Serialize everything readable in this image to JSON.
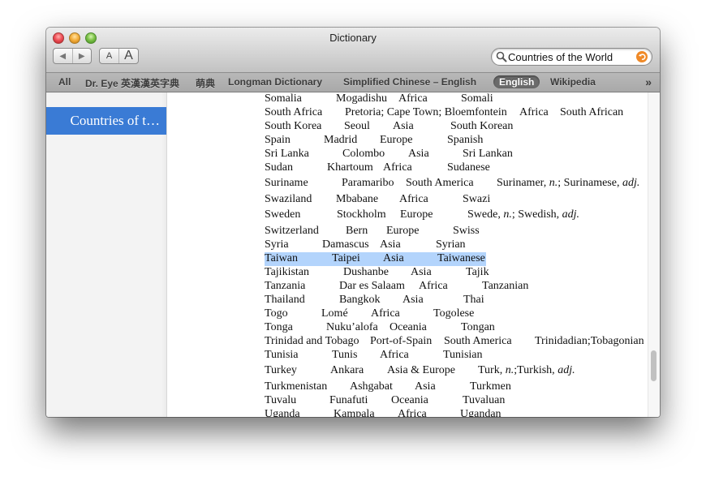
{
  "window": {
    "title": "Dictionary",
    "traffic_lights": [
      "close",
      "minimize",
      "zoom"
    ]
  },
  "toolbar": {
    "back_icon": "triangle-left-icon",
    "forward_icon": "triangle-right-icon",
    "back_glyph": "◀",
    "forward_glyph": "▶",
    "font_smaller_label": "A",
    "font_larger_label": "A",
    "search": {
      "value": "Countries of the World",
      "icon": "magnifier-icon",
      "clear_icon": "clear-circle-icon"
    }
  },
  "sources": {
    "tabs": [
      {
        "label": "All",
        "active": false
      },
      {
        "label": "Dr. Eye 英漢漢英字典",
        "active": false
      },
      {
        "label": "萌典",
        "active": false
      },
      {
        "label": "Longman Dictionary",
        "active": false
      },
      {
        "label": "Simplified Chinese – English",
        "active": false
      },
      {
        "label": "English",
        "active": true
      },
      {
        "label": "Wikipedia",
        "active": false
      }
    ],
    "more_glyph": "»"
  },
  "sidebar": {
    "items": [
      {
        "label": "Countries of t…",
        "selected": true
      }
    ]
  },
  "entry": {
    "rows": [
      {
        "country": "Somalia",
        "capital": "Mogadishu",
        "continent": "Africa",
        "adjective": "Somali"
      },
      {
        "country": "South Africa",
        "capital": "Pretoria; Cape Town; Bloemfontein",
        "continent": "Africa",
        "adjective": "South African"
      },
      {
        "country": "South Korea",
        "capital": "Seoul",
        "continent": "Asia",
        "adjective": "South Korean"
      },
      {
        "country": "Spain",
        "capital": "Madrid",
        "continent": "Europe",
        "adjective": "Spanish"
      },
      {
        "country": "Sri Lanka",
        "capital": "Colombo",
        "continent": "Asia",
        "adjective": "Sri Lankan"
      },
      {
        "country": "Sudan",
        "capital": "Khartoum",
        "continent": "Africa",
        "adjective": "Sudanese"
      },
      {
        "country": "Suriname",
        "capital": "Paramaribo",
        "continent": "South America",
        "adjective": "Surinamer, n.; Surinamese, adj."
      },
      {
        "country": "Swaziland",
        "capital": "Mbabane",
        "continent": "Africa",
        "adjective": "Swazi"
      },
      {
        "country": "Sweden",
        "capital": "Stockholm",
        "continent": "Europe",
        "adjective": "Swede, n.; Swedish, adj."
      },
      {
        "country": "Switzerland",
        "capital": "Bern",
        "continent": "Europe",
        "adjective": "Swiss"
      },
      {
        "country": "Syria",
        "capital": "Damascus",
        "continent": "Asia",
        "adjective": "Syrian"
      },
      {
        "country": "Taiwan",
        "capital": "Taipei",
        "continent": "Asia",
        "adjective": "Taiwanese",
        "selected": true
      },
      {
        "country": "Tajikistan",
        "capital": "Dushanbe",
        "continent": "Asia",
        "adjective": "Tajik"
      },
      {
        "country": "Tanzania",
        "capital": "Dar es Salaam",
        "continent": "Africa",
        "adjective": "Tanzanian"
      },
      {
        "country": "Thailand",
        "capital": "Bangkok",
        "continent": "Asia",
        "adjective": "Thai"
      },
      {
        "country": "Togo",
        "capital": "Lomé",
        "continent": "Africa",
        "adjective": "Togolese"
      },
      {
        "country": "Tonga",
        "capital": "Nuku’alofa",
        "continent": "Oceania",
        "adjective": "Tongan"
      },
      {
        "country": "Trinidad and Tobago",
        "capital": "Port-of-Spain",
        "continent": "South America",
        "adjective": "Trinidadian;Tobagonian"
      },
      {
        "country": "Tunisia",
        "capital": "Tunis",
        "continent": "Africa",
        "adjective": "Tunisian"
      },
      {
        "country": "Turkey",
        "capital": "Ankara",
        "continent": "Asia & Europe",
        "adjective": "Turk, n.;Turkish, adj."
      },
      {
        "country": "Turkmenistan",
        "capital": "Ashgabat",
        "continent": "Asia",
        "adjective": "Turkmen"
      },
      {
        "country": "Tuvalu",
        "capital": "Funafuti",
        "continent": "Oceania",
        "adjective": "Tuvaluan"
      },
      {
        "country": "Uganda",
        "capital": "Kampala",
        "continent": "Africa",
        "adjective": "Ugandan"
      }
    ]
  },
  "scrollbar": {
    "position_fraction": 0.85
  }
}
